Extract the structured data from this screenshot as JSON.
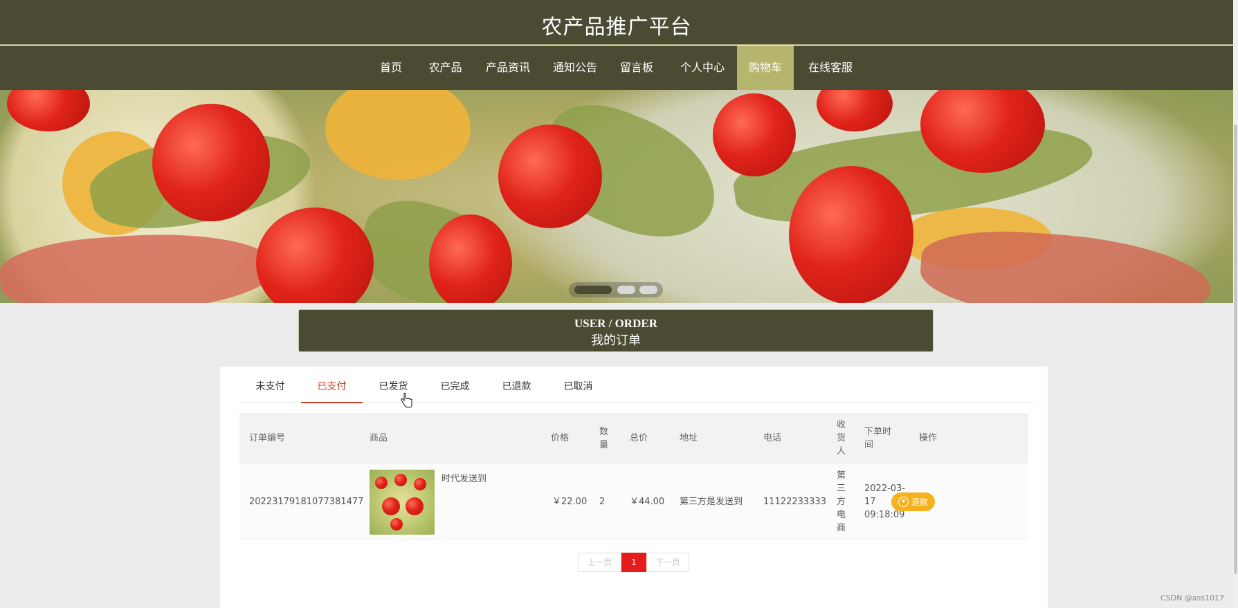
{
  "site": {
    "title": "农产品推广平台"
  },
  "nav": {
    "items": [
      {
        "label": "首页"
      },
      {
        "label": "农产品"
      },
      {
        "label": "产品资讯"
      },
      {
        "label": "通知公告"
      },
      {
        "label": "留言板"
      },
      {
        "label": "个人中心"
      },
      {
        "label": "购物车"
      },
      {
        "label": "在线客服"
      }
    ],
    "active": "购物车"
  },
  "banner": {
    "slide_count": 3,
    "active_slide": 1
  },
  "section": {
    "title_en": "USER / ORDER",
    "title_cn": "我的订单"
  },
  "tabs": {
    "items": [
      {
        "label": "未支付"
      },
      {
        "label": "已支付"
      },
      {
        "label": "已发货"
      },
      {
        "label": "已完成"
      },
      {
        "label": "已退款"
      },
      {
        "label": "已取消"
      }
    ],
    "active": "已支付"
  },
  "table": {
    "headers": {
      "order_no": "订单编号",
      "product": "商品",
      "price": "价格",
      "qty": "数量",
      "total": "总价",
      "address": "地址",
      "phone": "电话",
      "receiver": "收货人",
      "time": "下单时间",
      "action": "操作"
    },
    "rows": [
      {
        "order_no": "20223179181077381477",
        "product_name": "时代发送到",
        "price": "￥22.00",
        "qty": "2",
        "total": "￥44.00",
        "address": "第三方是发送到",
        "phone": "11122233333",
        "receiver": "第三方电商",
        "time": "2022-03-17 09:18:09",
        "action_label": "退款"
      }
    ]
  },
  "pagination": {
    "prev": "上一页",
    "current": "1",
    "next": "下一页"
  },
  "watermark": "CSDN @ass1017",
  "colors": {
    "header_bg": "#4b4a33",
    "nav_active": "#b6b56e",
    "tab_active": "#d0402b",
    "refund_btn": "#f5b21e",
    "page_current": "#e41c1c"
  }
}
